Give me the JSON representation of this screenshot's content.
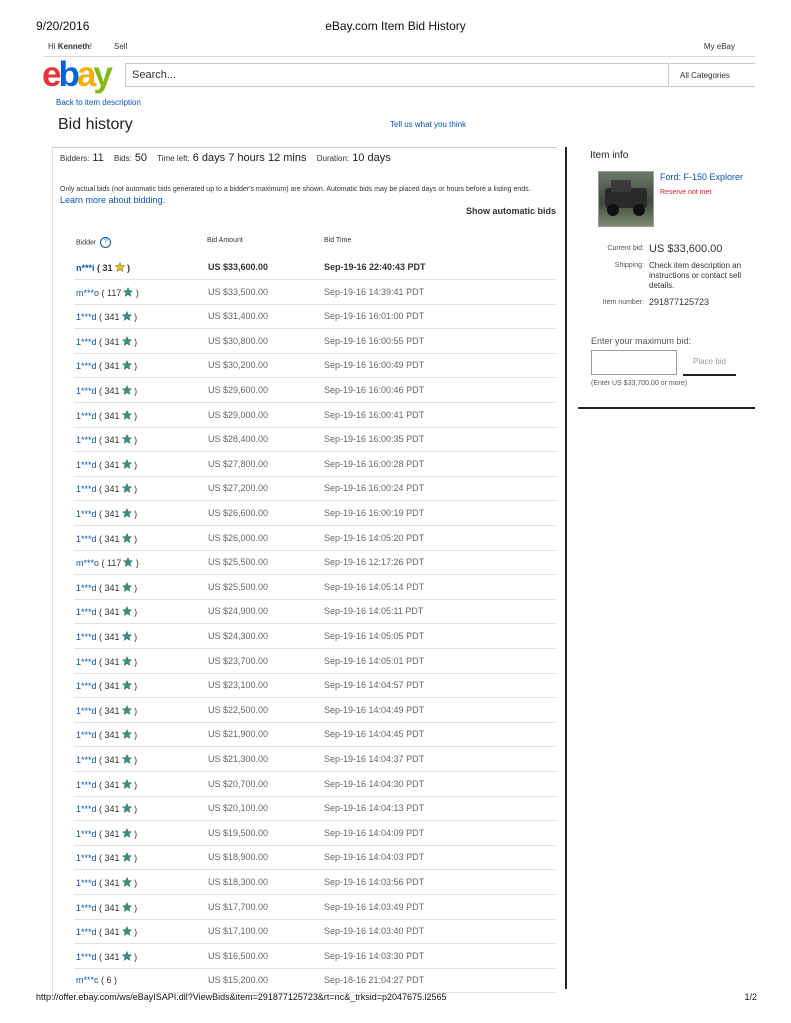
{
  "print_header": {
    "date": "9/20/2016",
    "title": "eBay.com Item Bid History"
  },
  "topnav": {
    "hi": "Hi",
    "user": "Kenneth",
    "exclaim": "!",
    "sell": "Sell",
    "my_ebay": "My eBay"
  },
  "logo": {
    "e": "e",
    "b": "b",
    "a": "a",
    "y": "y"
  },
  "search": {
    "placeholder": "Search...",
    "category": "All Categories"
  },
  "back_link": "Back to item description",
  "page_title": "Bid history",
  "feedback_link": "Tell us what you think",
  "stats": {
    "bidders_label": "Bidders:",
    "bidders": "11",
    "bids_label": "Bids:",
    "bids": "50",
    "time_left_label": "Time left:",
    "time_left": "6 days 7 hours 12 mins",
    "duration_label": "Duration:",
    "duration": "10 days"
  },
  "note": {
    "text": "Only actual bids (not automatic bids generated up to a bidder's maximum) are shown. Automatic bids may be placed days or hours before a listing ends.",
    "link": "Learn more about bidding."
  },
  "show_automatic": "Show automatic bids",
  "table_headers": {
    "bidder": "Bidder",
    "amount": "Bid Amount",
    "time": "Bid Time",
    "help_icon": "?"
  },
  "colors": {
    "link": "#0654ba",
    "star_yellow": "#f5c400",
    "star_teal": "#1f9a8e",
    "reserve": "#dd1e31"
  },
  "bids": [
    {
      "bidder": "n***i",
      "score": "31",
      "star": "yellow-star-icon",
      "amount": "US $33,600.00",
      "time": "Sep-19-16 22:40:43 PDT",
      "bold": true
    },
    {
      "bidder": "m***o",
      "score": "117",
      "star": "teal-star-icon",
      "amount": "US $33,500.00",
      "time": "Sep-19-16 14:39:41 PDT"
    },
    {
      "bidder": "1***d",
      "score": "341",
      "star": "teal-star-icon",
      "amount": "US $31,400.00",
      "time": "Sep-19-16 16:01:00 PDT"
    },
    {
      "bidder": "1***d",
      "score": "341",
      "star": "teal-star-icon",
      "amount": "US $30,800.00",
      "time": "Sep-19-16 16:00:55 PDT"
    },
    {
      "bidder": "1***d",
      "score": "341",
      "star": "teal-star-icon",
      "amount": "US $30,200.00",
      "time": "Sep-19-16 16:00:49 PDT"
    },
    {
      "bidder": "1***d",
      "score": "341",
      "star": "teal-star-icon",
      "amount": "US $29,600.00",
      "time": "Sep-19-16 16:00:46 PDT"
    },
    {
      "bidder": "1***d",
      "score": "341",
      "star": "teal-star-icon",
      "amount": "US $29,000.00",
      "time": "Sep-19-16 16:00:41 PDT"
    },
    {
      "bidder": "1***d",
      "score": "341",
      "star": "teal-star-icon",
      "amount": "US $28,400.00",
      "time": "Sep-19-16 16:00:35 PDT"
    },
    {
      "bidder": "1***d",
      "score": "341",
      "star": "teal-star-icon",
      "amount": "US $27,800.00",
      "time": "Sep-19-16 16:00:28 PDT"
    },
    {
      "bidder": "1***d",
      "score": "341",
      "star": "teal-star-icon",
      "amount": "US $27,200.00",
      "time": "Sep-19-16 16:00:24 PDT"
    },
    {
      "bidder": "1***d",
      "score": "341",
      "star": "teal-star-icon",
      "amount": "US $26,600.00",
      "time": "Sep-19-16 16:00:19 PDT"
    },
    {
      "bidder": "1***d",
      "score": "341",
      "star": "teal-star-icon",
      "amount": "US $26,000.00",
      "time": "Sep-19-16 14:05:20 PDT"
    },
    {
      "bidder": "m***o",
      "score": "117",
      "star": "teal-star-icon",
      "amount": "US $25,500.00",
      "time": "Sep-19-16 12:17:26 PDT"
    },
    {
      "bidder": "1***d",
      "score": "341",
      "star": "teal-star-icon",
      "amount": "US $25,500.00",
      "time": "Sep-19-16 14:05:14 PDT"
    },
    {
      "bidder": "1***d",
      "score": "341",
      "star": "teal-star-icon",
      "amount": "US $24,900.00",
      "time": "Sep-19-16 14:05:11 PDT"
    },
    {
      "bidder": "1***d",
      "score": "341",
      "star": "teal-star-icon",
      "amount": "US $24,300.00",
      "time": "Sep-19-16 14:05:05 PDT"
    },
    {
      "bidder": "1***d",
      "score": "341",
      "star": "teal-star-icon",
      "amount": "US $23,700.00",
      "time": "Sep-19-16 14:05:01 PDT"
    },
    {
      "bidder": "1***d",
      "score": "341",
      "star": "teal-star-icon",
      "amount": "US $23,100.00",
      "time": "Sep-19-16 14:04:57 PDT"
    },
    {
      "bidder": "1***d",
      "score": "341",
      "star": "teal-star-icon",
      "amount": "US $22,500.00",
      "time": "Sep-19-16 14:04:49 PDT"
    },
    {
      "bidder": "1***d",
      "score": "341",
      "star": "teal-star-icon",
      "amount": "US $21,900.00",
      "time": "Sep-19-16 14:04:45 PDT"
    },
    {
      "bidder": "1***d",
      "score": "341",
      "star": "teal-star-icon",
      "amount": "US $21,300.00",
      "time": "Sep-19-16 14:04:37 PDT"
    },
    {
      "bidder": "1***d",
      "score": "341",
      "star": "teal-star-icon",
      "amount": "US $20,700.00",
      "time": "Sep-19-16 14:04:30 PDT"
    },
    {
      "bidder": "1***d",
      "score": "341",
      "star": "teal-star-icon",
      "amount": "US $20,100.00",
      "time": "Sep-19-16 14:04:13 PDT"
    },
    {
      "bidder": "1***d",
      "score": "341",
      "star": "teal-star-icon",
      "amount": "US $19,500.00",
      "time": "Sep-19-16 14:04:09 PDT"
    },
    {
      "bidder": "1***d",
      "score": "341",
      "star": "teal-star-icon",
      "amount": "US $18,900.00",
      "time": "Sep-19-16 14:04:03 PDT"
    },
    {
      "bidder": "1***d",
      "score": "341",
      "star": "teal-star-icon",
      "amount": "US $18,300.00",
      "time": "Sep-19-16 14:03:56 PDT"
    },
    {
      "bidder": "1***d",
      "score": "341",
      "star": "teal-star-icon",
      "amount": "US $17,700.00",
      "time": "Sep-19-16 14:03:49 PDT"
    },
    {
      "bidder": "1***d",
      "score": "341",
      "star": "teal-star-icon",
      "amount": "US $17,100.00",
      "time": "Sep-19-16 14:03:40 PDT"
    },
    {
      "bidder": "1***d",
      "score": "341",
      "star": "teal-star-icon",
      "amount": "US $16,500.00",
      "time": "Sep-19-16 14:03:30 PDT"
    },
    {
      "bidder": "m***c",
      "score": "6",
      "star": "",
      "amount": "US $15,200.00",
      "time": "Sep-18-16 21:04:27 PDT"
    }
  ],
  "item_info": {
    "heading": "Item info",
    "title": "Ford: F-150 Explorer",
    "reserve": "Reserve not met",
    "current_bid_label": "Current bid:",
    "current_bid": "US $33,600.00",
    "shipping_label": "Shipping:",
    "shipping_l1": "Check item description an",
    "shipping_l2": "instructions or contact sell",
    "shipping_l3": "details.",
    "item_number_label": "Item number:",
    "item_number": "291877125723",
    "max_bid_label": "Enter your maximum bid:",
    "place_bid": "Place bid",
    "min_bid_note": "(Enter US $33,700.00 or more)"
  },
  "print_footer": {
    "url": "http://offer.ebay.com/ws/eBayISAPI.dll?ViewBids&item=291877125723&rt=nc&_trksid=p2047675.l2565",
    "page": "1/2"
  }
}
